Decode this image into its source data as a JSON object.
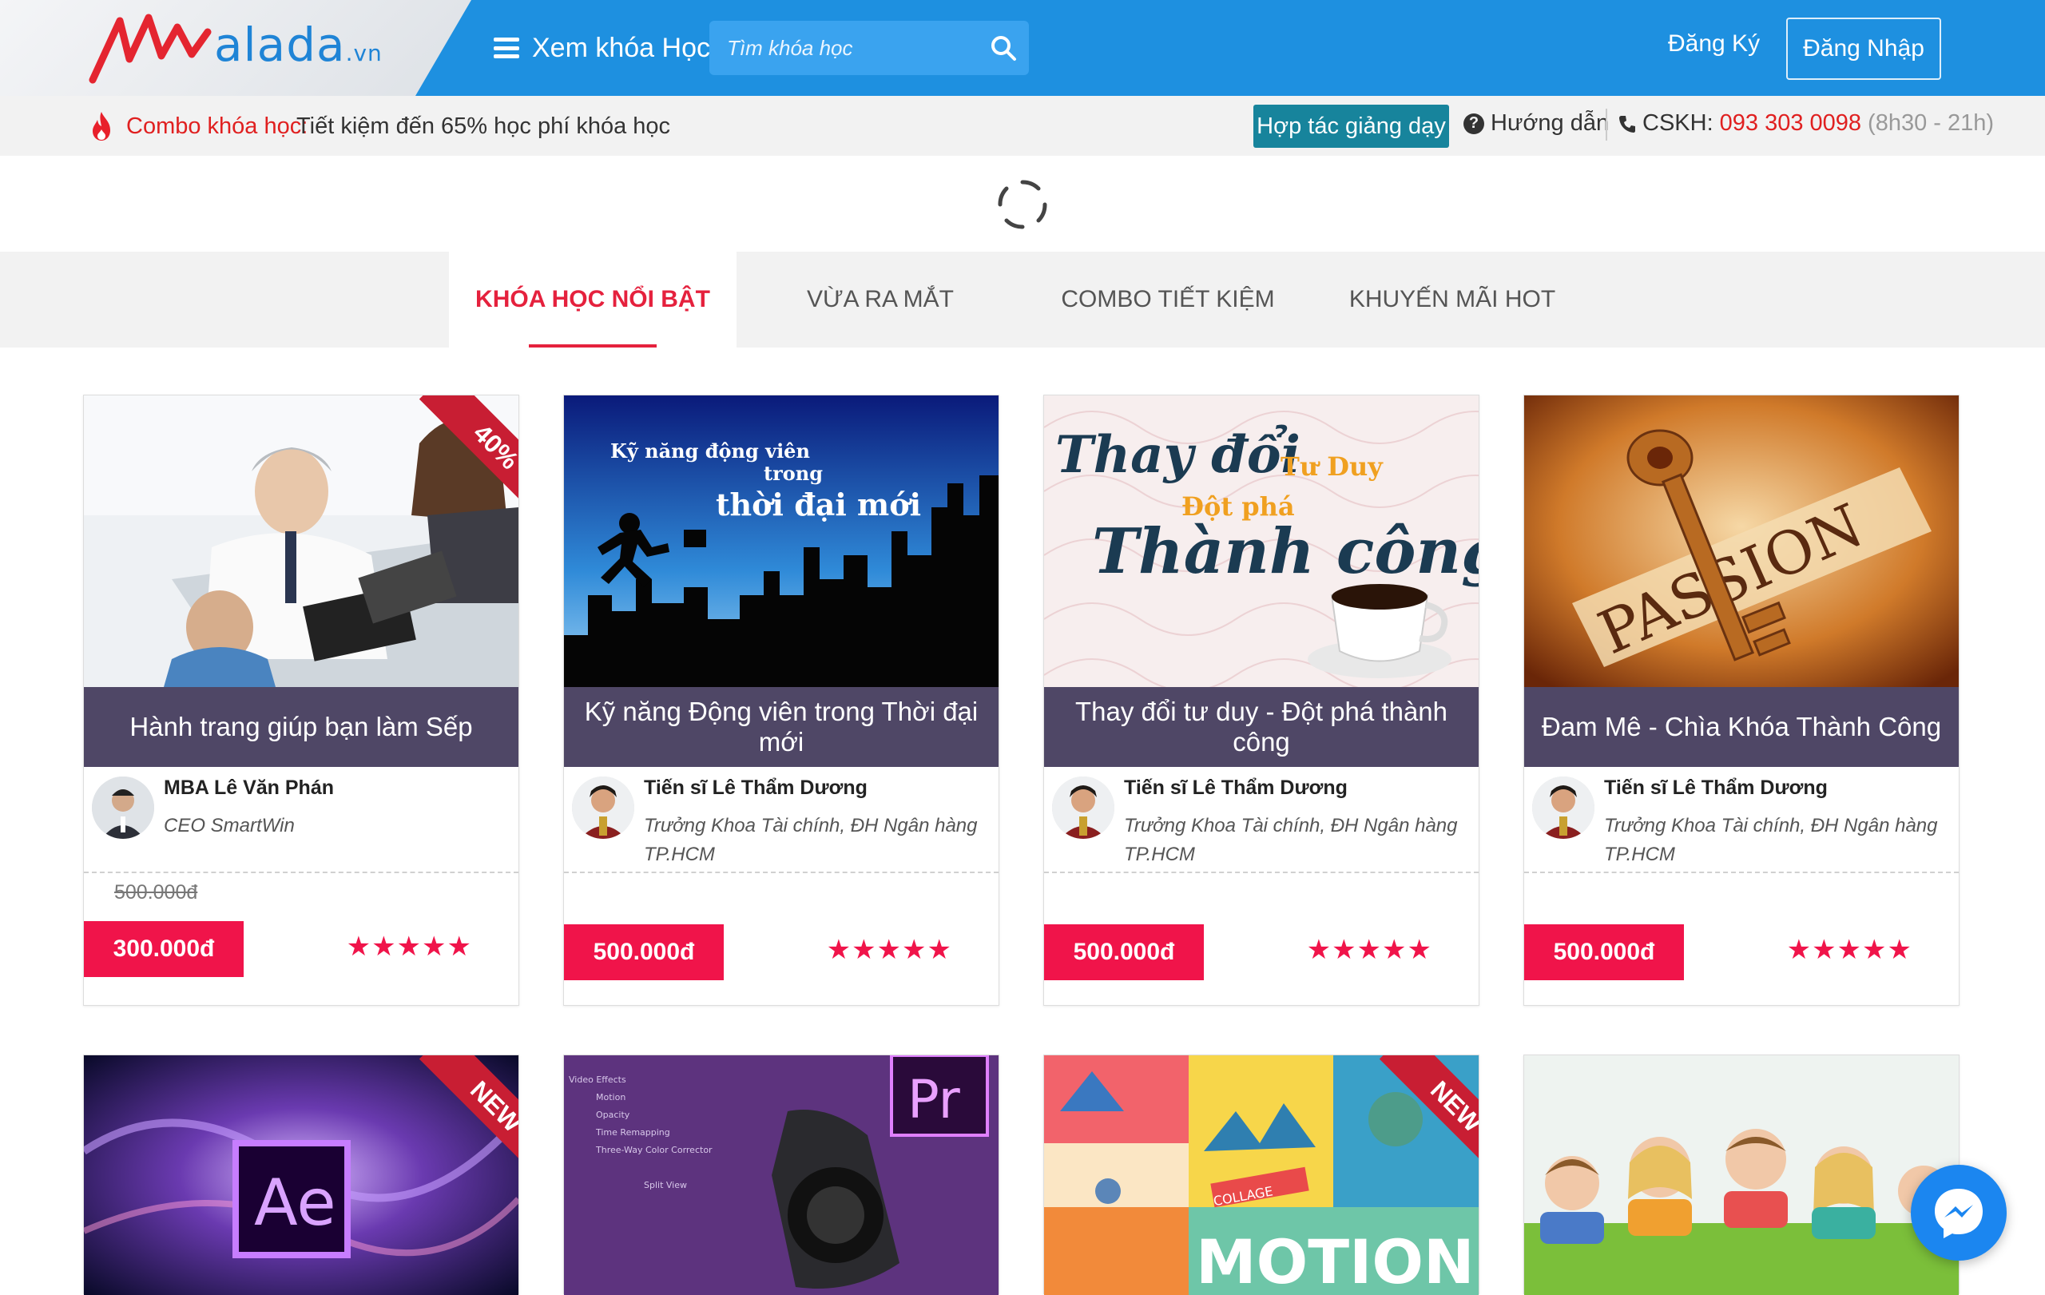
{
  "header": {
    "logo_text": "alada",
    "logo_tld": ".vn",
    "browse_label": "Xem khóa Học",
    "search_placeholder": "Tìm khóa học",
    "signup_label": "Đăng Ký",
    "login_label": "Đăng Nhập"
  },
  "subbar": {
    "combo_label": "Combo khóa học:",
    "combo_desc": "Tiết kiệm đến 65% học phí khóa học",
    "partner_label": "Hợp tác giảng dạy",
    "guide_label": "Hướng dẫn",
    "cskh_label": "CSKH:",
    "cskh_phone": "093 303 0098",
    "cskh_hours": "(8h30 - 21h)"
  },
  "tabs": [
    {
      "label": "KHÓA HỌC NỔI BẬT",
      "active": true
    },
    {
      "label": "VỪA RA MẮT"
    },
    {
      "label": "COMBO TIẾT KIỆM"
    },
    {
      "label": "KHUYẾN MÃI HOT"
    }
  ],
  "courses": [
    {
      "title": "Hành trang giúp bạn làm Sếp",
      "author": "MBA Lê Văn Phán",
      "role": "CEO SmartWin",
      "old_price": "500.000đ",
      "price": "300.000đ",
      "rating": 5,
      "badge": "40%"
    },
    {
      "title": "Kỹ năng Động viên trong Thời đại mới",
      "author": "Tiến sĩ Lê Thẩm Dương",
      "role": "Trưởng Khoa Tài chính, ĐH Ngân hàng TP.HCM",
      "price": "500.000đ",
      "rating": 5,
      "image_text": [
        "Kỹ năng động viên",
        "trong",
        "thời đại mới"
      ]
    },
    {
      "title": "Thay đổi tư duy - Đột phá thành công",
      "author": "Tiến sĩ Lê Thẩm Dương",
      "role": "Trưởng Khoa Tài chính, ĐH Ngân hàng TP.HCM",
      "price": "500.000đ",
      "rating": 5,
      "image_text": [
        "Thay đổi",
        "Tư Duy",
        "Đột phá",
        "Thành công"
      ]
    },
    {
      "title": "Đam Mê - Chìa Khóa Thành Công",
      "author": "Tiến sĩ Lê Thẩm Dương",
      "role": "Trưởng Khoa Tài chính, ĐH Ngân hàng TP.HCM",
      "price": "500.000đ",
      "rating": 5,
      "image_text": [
        "PASSION"
      ]
    }
  ],
  "second_row": [
    {
      "badge": "NEW",
      "image_text": [
        "Ae"
      ]
    },
    {
      "image_text": [
        "Pr",
        "Video Effects",
        "Motion",
        "Opacity",
        "Time Remapping",
        "Three-Way Color Corrector",
        "Split View"
      ]
    },
    {
      "badge": "NEW",
      "image_text": [
        "MOTION",
        "COLLAGE"
      ]
    },
    {}
  ],
  "stars_glyph": "★★★★★",
  "colors": {
    "header_blue": "#1e90e0",
    "accent_red": "#e5213d",
    "price_red": "#f0144a",
    "title_band": "#4f4766",
    "partner_teal": "#17849c"
  }
}
